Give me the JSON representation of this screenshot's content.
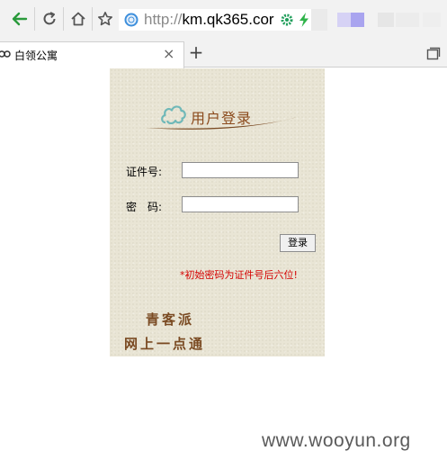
{
  "browser": {
    "url_protocol": "http://",
    "url_host": "km.qk365.cor",
    "tab_title": "白领公寓",
    "tab_close": "×",
    "new_tab": "+"
  },
  "login": {
    "title": "用户登录",
    "id_label": "证件号:",
    "password_label": "密　码:",
    "id_value": "",
    "password_value": "",
    "submit_label": "登录",
    "hint": "*初始密码为证件号后六位!",
    "brand_line1": "青客派",
    "brand_line2": "网上一点通"
  },
  "watermark": "www.wooyun.org",
  "colors": {
    "panel_bg": "#e9e5d5",
    "title_brown": "#8b4a1c",
    "hint_red": "#d40000",
    "back_arrow_green": "#2a9a3c"
  }
}
